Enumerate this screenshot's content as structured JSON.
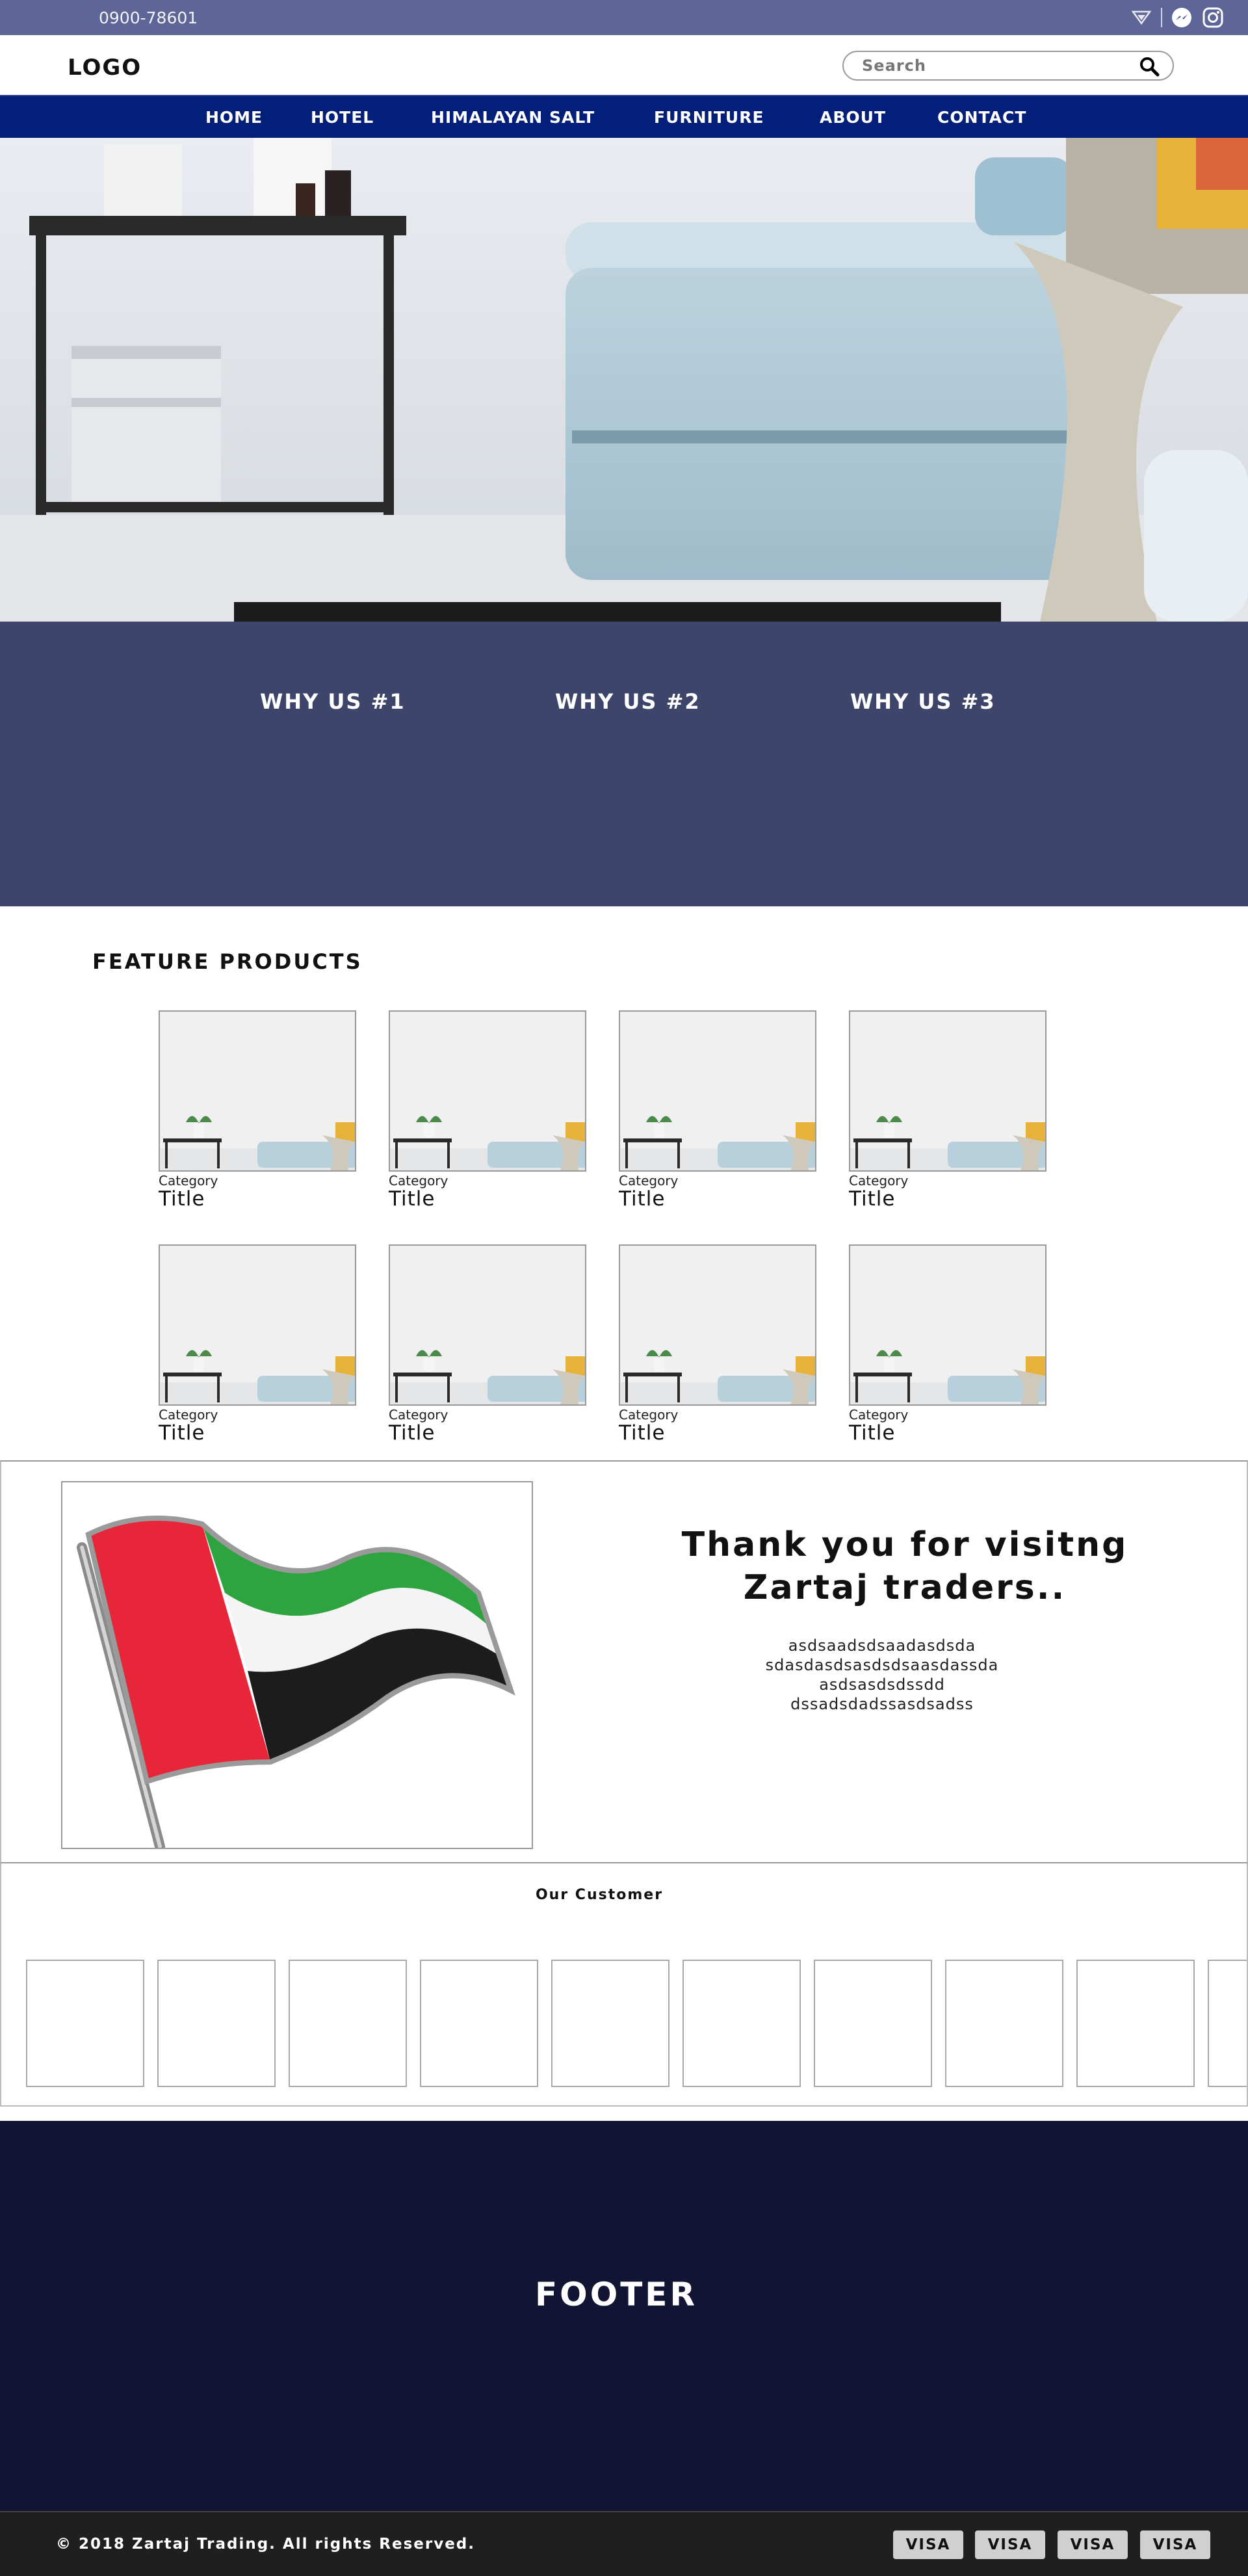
{
  "topbar": {
    "phone": "0900-78601",
    "icons": [
      "dropdown-arrow-icon",
      "messenger-icon",
      "instagram-icon"
    ]
  },
  "header": {
    "logo": "LOGO",
    "search": {
      "placeholder": "Search",
      "value": ""
    }
  },
  "nav": {
    "items": [
      {
        "label": "HOME"
      },
      {
        "label": "HOTEL"
      },
      {
        "label": "HIMALAYAN SALT"
      },
      {
        "label": "FURNITURE"
      },
      {
        "label": "ABOUT"
      },
      {
        "label": "CONTACT"
      }
    ]
  },
  "why_us": [
    "WHY US #1",
    "WHY US #2",
    "WHY US #3"
  ],
  "feature": {
    "title": "FEATURE PRODUCTS",
    "products": [
      {
        "category": "Category",
        "title": "Title"
      },
      {
        "category": "Category",
        "title": "Title"
      },
      {
        "category": "Category",
        "title": "Title"
      },
      {
        "category": "Category",
        "title": "Title"
      },
      {
        "category": "Category",
        "title": "Title"
      },
      {
        "category": "Category",
        "title": "Title"
      },
      {
        "category": "Category",
        "title": "Title"
      },
      {
        "category": "Category",
        "title": "Title"
      }
    ]
  },
  "thanks": {
    "heading": "Thank you for visitng Zartaj traders..",
    "body_lines": [
      "asdsaadsdsaadasdsda",
      "sdasdasdsasdsdsaasdassda",
      "asdsasdsdssdd",
      "dssadsdadssasdsadss"
    ]
  },
  "customers": {
    "title": "Our Customer"
  },
  "footer": {
    "title": "FOOTER",
    "copyright": "© 2018 Zartaj Trading. All rights Reserved.",
    "payments": [
      "VISA",
      "VISA",
      "VISA",
      "VISA"
    ]
  },
  "colors": {
    "topbar": "#5e6698",
    "nav": "#041f7a",
    "why_us_band": "#3e456b",
    "footer": "#121434",
    "bottom_bar": "#1f1f1f"
  }
}
